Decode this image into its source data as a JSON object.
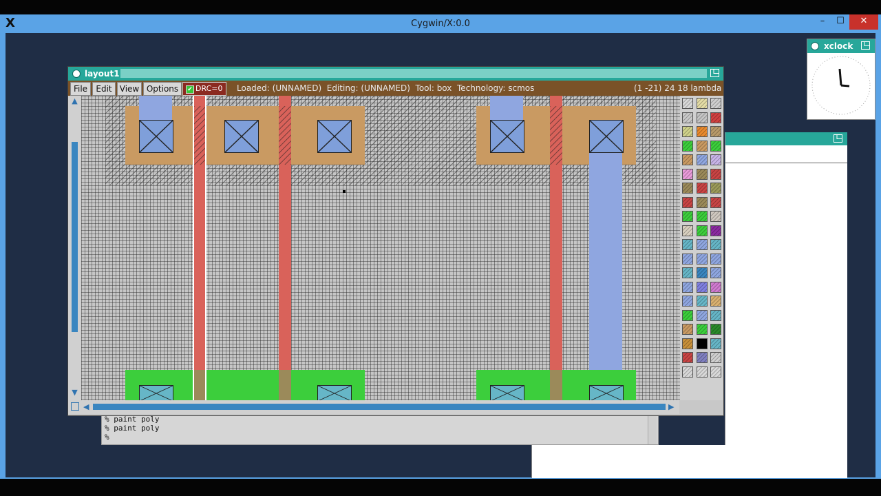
{
  "cygwin": {
    "title": "Cygwin/X:0.0",
    "logo": "X",
    "min": "–",
    "max": "☐",
    "close": "✕"
  },
  "xclock": {
    "title": "xclock"
  },
  "layout": {
    "title": "layout1",
    "menu": {
      "file": "File",
      "edit": "Edit",
      "view": "View",
      "options": "Options"
    },
    "drc": {
      "label": "DRC=0",
      "checked": "✔"
    },
    "status": "Loaded: (UNNAMED)  Editing: (UNNAMED)  Tool: box  Technology: scmos",
    "coords": "(1 -21) 24 18 lambda"
  },
  "console": {
    "lines": [
      "% paint poly",
      "% paint poly",
      "%"
    ]
  },
  "colors": {
    "diffusion": "#c99a62",
    "poly": "#d9625a",
    "metal": "#8fa6e0",
    "active": "#3cce3c",
    "titlebar": "#27a79a",
    "menubar": "#7a5228"
  },
  "palette": {
    "swatches": [
      "#d8d8d8",
      "#e4dca6",
      "#cfcfcf",
      "#c9c9c9",
      "#c4c4c4",
      "#d04040",
      "#cfd28a",
      "#e8892c",
      "#b89a6a",
      "#3cce3c",
      "#c99a62",
      "#3cce3c",
      "#c99a62",
      "#8fa6e0",
      "#c8b4e8",
      "#e89ad8",
      "#9b8a5a",
      "#c84444",
      "#9b8a5a",
      "#c84444",
      "#9b9a5a",
      "#c84444",
      "#9b8a5a",
      "#c84444",
      "#3cce3c",
      "#3cce3c",
      "#d0c8c0",
      "#d8d0c0",
      "#3cce3c",
      "#8a2aa0",
      "#66b6c7",
      "#8fa6e0",
      "#66b6c7",
      "#8fa6e0",
      "#8fa6e0",
      "#8fa6e0",
      "#66b6c7",
      "#3a86c0",
      "#8fa6e0",
      "#8fa6e0",
      "#8080e0",
      "#d07ad0",
      "#8fa6e0",
      "#66b6c7",
      "#d8b070",
      "#3cce3c",
      "#8fa6e0",
      "#66b6c7",
      "#c99a62",
      "#3cce3c",
      "#2a8a2a",
      "#c8903a",
      "#000000",
      "#66b6c7",
      "#c84444",
      "#8080c0",
      "#d0d0d0",
      "#d8d8d8",
      "#d8d8d8",
      "#d8d8d8"
    ]
  }
}
